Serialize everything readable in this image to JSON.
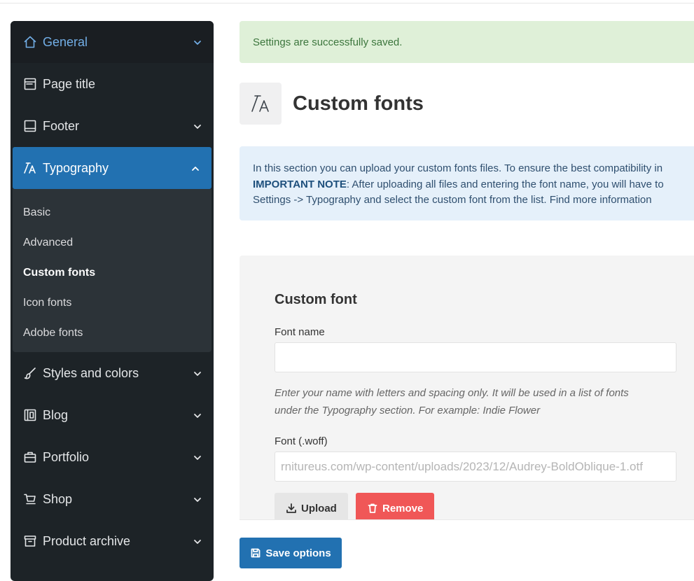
{
  "sidebar": {
    "items": [
      {
        "label": "General",
        "icon": "home-icon"
      },
      {
        "label": "Page title",
        "icon": "page-title-icon"
      },
      {
        "label": "Footer",
        "icon": "footer-icon"
      },
      {
        "label": "Typography",
        "icon": "typography-icon"
      },
      {
        "label": "Styles and colors",
        "icon": "brush-icon"
      },
      {
        "label": "Blog",
        "icon": "blog-icon"
      },
      {
        "label": "Portfolio",
        "icon": "briefcase-icon"
      },
      {
        "label": "Shop",
        "icon": "cart-icon"
      },
      {
        "label": "Product archive",
        "icon": "archive-icon"
      }
    ],
    "typography_sub": [
      "Basic",
      "Advanced",
      "Custom fonts",
      "Icon fonts",
      "Adobe fonts"
    ],
    "active_item": "Typography",
    "current_sub": "Custom fonts"
  },
  "alert": {
    "text": "Settings are successfully saved."
  },
  "page": {
    "title": "Custom fonts",
    "icon": "typography-icon"
  },
  "info": {
    "line1": "In this section you can upload your custom fonts files. To ensure the best compatibility in",
    "important": "IMPORTANT NOTE",
    "line2_rest": ": After uploading all files and entering the font name, you will have to",
    "line3": "Settings -> Typography and select the custom font from the list. Find more information"
  },
  "card": {
    "title": "Custom font",
    "font_name_label": "Font name",
    "font_name_value": "",
    "help_line1": "Enter your name with letters and spacing only. It will be used in a list of fonts",
    "help_line2": "under the Typography section. For example: Indie Flower",
    "woff_label": "Font (.woff)",
    "woff_value": "rnitureus.com/wp-content/uploads/2023/12/Audrey-BoldOblique-1.otf",
    "upload_label": "Upload",
    "remove_label": "Remove"
  },
  "save": {
    "label": "Save options"
  },
  "colors": {
    "sidebar_bg": "#1d2327",
    "accent": "#2271b1",
    "success_bg": "#dff0d8",
    "info_bg": "#e5f0fa",
    "danger": "#f05757"
  }
}
